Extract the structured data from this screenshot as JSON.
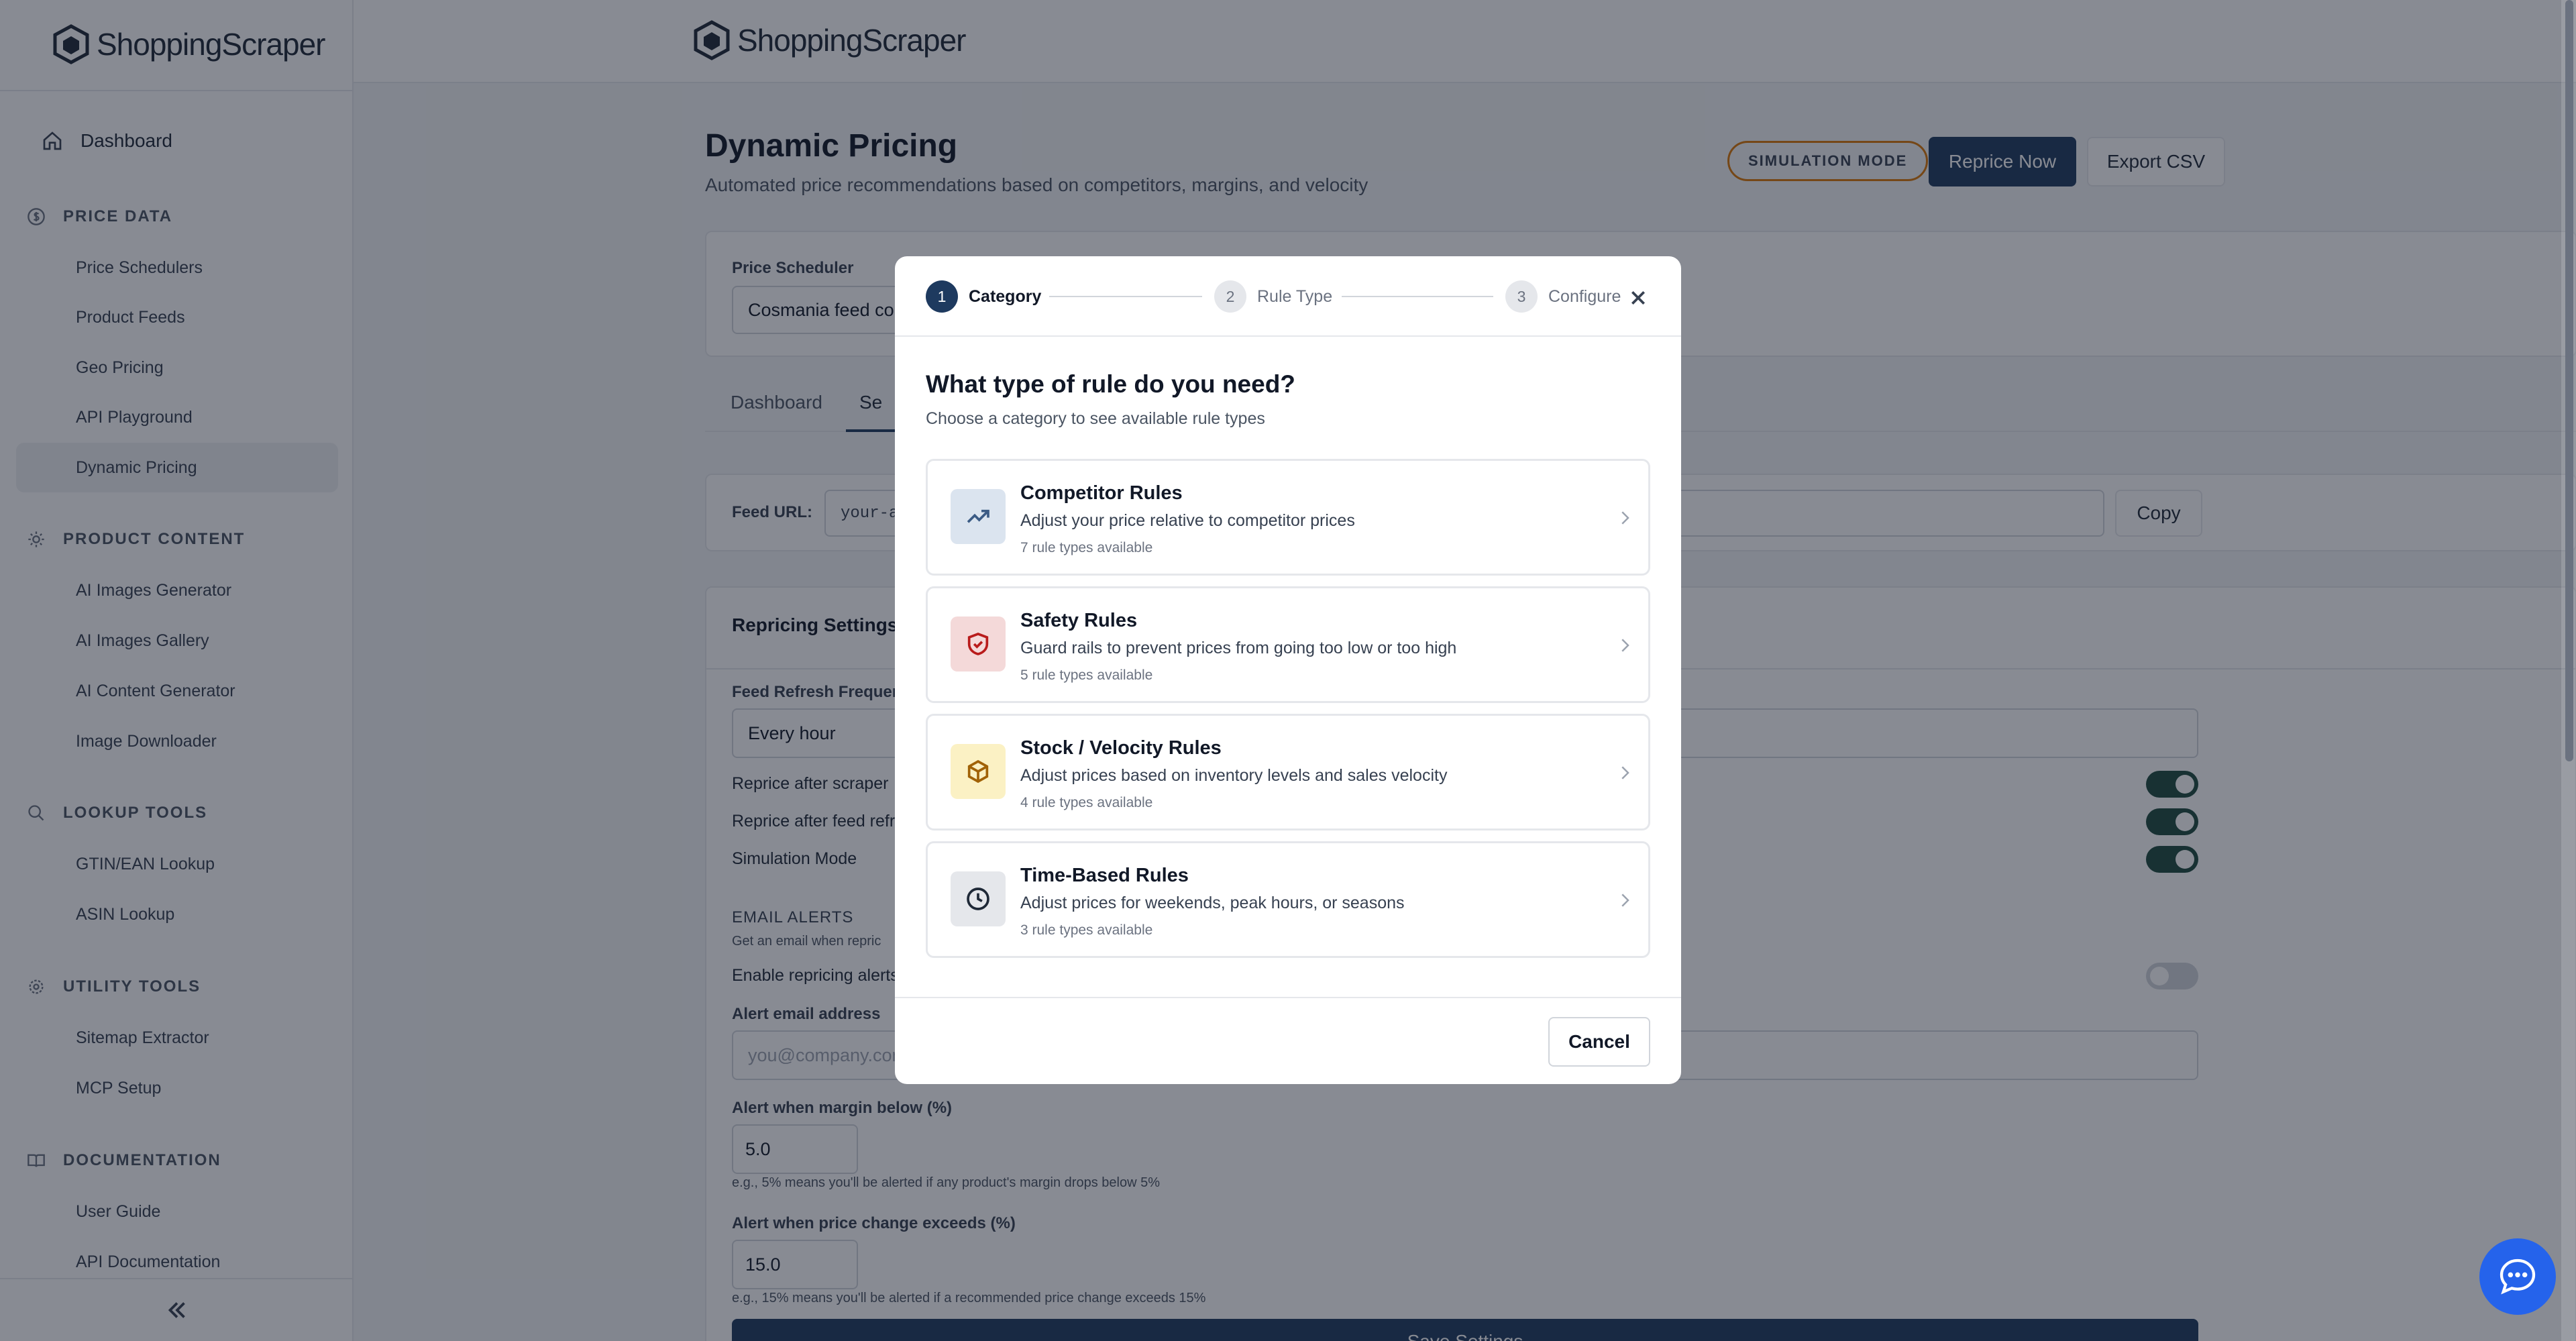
{
  "brand": {
    "name": "ShoppingScraper"
  },
  "sidebar": {
    "dashboard": "Dashboard",
    "sections": [
      {
        "title": "PRICE DATA",
        "items": [
          "Price Schedulers",
          "Product Feeds",
          "Geo Pricing",
          "API Playground",
          "Dynamic Pricing"
        ]
      },
      {
        "title": "PRODUCT CONTENT",
        "items": [
          "AI Images Generator",
          "AI Images Gallery",
          "AI Content Generator",
          "Image Downloader"
        ]
      },
      {
        "title": "LOOKUP TOOLS",
        "items": [
          "GTIN/EAN Lookup",
          "ASIN Lookup"
        ]
      },
      {
        "title": "UTILITY TOOLS",
        "items": [
          "Sitemap Extractor",
          "MCP Setup"
        ]
      },
      {
        "title": "DOCUMENTATION",
        "items": [
          "User Guide",
          "API Documentation"
        ]
      }
    ],
    "active_item": "Dynamic Pricing"
  },
  "page": {
    "title": "Dynamic Pricing",
    "subtitle": "Automated price recommendations based on competitors, margins, and velocity",
    "simulation_badge": "SIMULATION MODE",
    "reprice_button": "Reprice Now",
    "export_button": "Export CSV",
    "scheduler_label": "Price Scheduler",
    "scheduler_value": "Cosmania feed co",
    "tabs": [
      "Dashboard",
      "Se"
    ],
    "feed_url_label": "Feed URL:",
    "feed_url_value": "your-ap",
    "copy_button": "Copy",
    "settings_title": "Repricing Settings",
    "refresh_label": "Feed Refresh Frequen",
    "refresh_value": "Every hour",
    "toggles": [
      {
        "label": "Reprice after scraper",
        "on": true
      },
      {
        "label": "Reprice after feed refr",
        "on": true
      },
      {
        "label": "Simulation Mode",
        "on": true
      }
    ],
    "email_alerts": {
      "heading": "EMAIL ALERTS",
      "sub": "Get an email when repric",
      "enable_label": "Enable repricing alerts",
      "enable_on": false,
      "email_label": "Alert email address",
      "email_placeholder": "you@company.con",
      "margin_label": "Alert when margin below (%)",
      "margin_value": "5.0",
      "margin_hint": "e.g., 5% means you'll be alerted if any product's margin drops below 5%",
      "change_label": "Alert when price change exceeds (%)",
      "change_value": "15.0",
      "change_hint": "e.g., 15% means you'll be alerted if a recommended price change exceeds 15%"
    },
    "save_button": "Save Settings"
  },
  "modal": {
    "steps": [
      {
        "num": "1",
        "label": "Category",
        "active": true
      },
      {
        "num": "2",
        "label": "Rule Type",
        "active": false
      },
      {
        "num": "3",
        "label": "Configure",
        "active": false
      }
    ],
    "title": "What type of rule do you need?",
    "subtitle": "Choose a category to see available rule types",
    "categories": [
      {
        "title": "Competitor Rules",
        "desc": "Adjust your price relative to competitor prices",
        "count": "7 rule types available",
        "icon": "trending-up-icon",
        "color": "#dbe4ef"
      },
      {
        "title": "Safety Rules",
        "desc": "Guard rails to prevent prices from going too low or too high",
        "count": "5 rule types available",
        "icon": "shield-check-icon",
        "color": "#f4d9d9"
      },
      {
        "title": "Stock / Velocity Rules",
        "desc": "Adjust prices based on inventory levels and sales velocity",
        "count": "4 rule types available",
        "icon": "box-icon",
        "color": "#fbf1c4"
      },
      {
        "title": "Time-Based Rules",
        "desc": "Adjust prices for weekends, peak hours, or seasons",
        "count": "3 rule types available",
        "icon": "clock-icon",
        "color": "#e5e7eb"
      }
    ],
    "cancel_button": "Cancel"
  },
  "colors": {
    "primary": "#1e3a5f",
    "toggle_on": "#1e4b3f",
    "chat": "#2563eb"
  }
}
